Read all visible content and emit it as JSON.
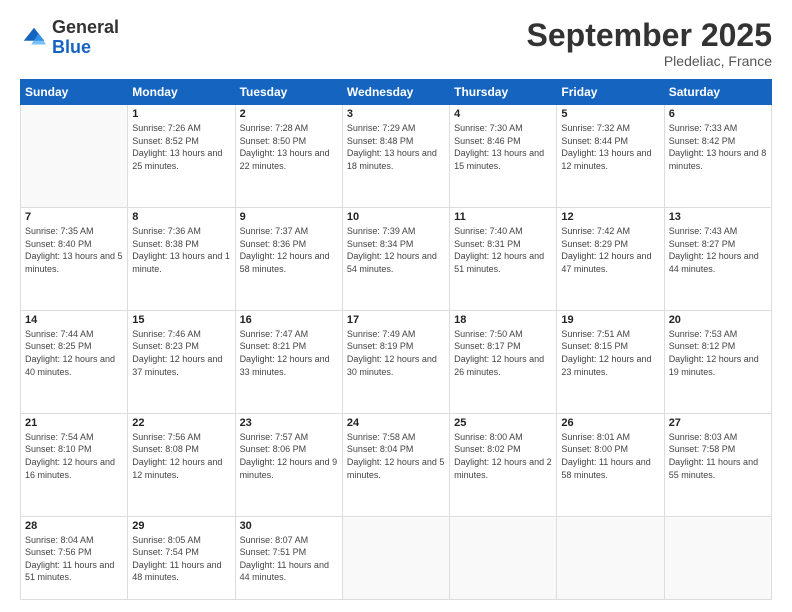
{
  "header": {
    "logo_general": "General",
    "logo_blue": "Blue",
    "month": "September 2025",
    "location": "Pledeliac, France"
  },
  "weekdays": [
    "Sunday",
    "Monday",
    "Tuesday",
    "Wednesday",
    "Thursday",
    "Friday",
    "Saturday"
  ],
  "weeks": [
    [
      {
        "day": "",
        "sunrise": "",
        "sunset": "",
        "daylight": ""
      },
      {
        "day": "1",
        "sunrise": "Sunrise: 7:26 AM",
        "sunset": "Sunset: 8:52 PM",
        "daylight": "Daylight: 13 hours and 25 minutes."
      },
      {
        "day": "2",
        "sunrise": "Sunrise: 7:28 AM",
        "sunset": "Sunset: 8:50 PM",
        "daylight": "Daylight: 13 hours and 22 minutes."
      },
      {
        "day": "3",
        "sunrise": "Sunrise: 7:29 AM",
        "sunset": "Sunset: 8:48 PM",
        "daylight": "Daylight: 13 hours and 18 minutes."
      },
      {
        "day": "4",
        "sunrise": "Sunrise: 7:30 AM",
        "sunset": "Sunset: 8:46 PM",
        "daylight": "Daylight: 13 hours and 15 minutes."
      },
      {
        "day": "5",
        "sunrise": "Sunrise: 7:32 AM",
        "sunset": "Sunset: 8:44 PM",
        "daylight": "Daylight: 13 hours and 12 minutes."
      },
      {
        "day": "6",
        "sunrise": "Sunrise: 7:33 AM",
        "sunset": "Sunset: 8:42 PM",
        "daylight": "Daylight: 13 hours and 8 minutes."
      }
    ],
    [
      {
        "day": "7",
        "sunrise": "Sunrise: 7:35 AM",
        "sunset": "Sunset: 8:40 PM",
        "daylight": "Daylight: 13 hours and 5 minutes."
      },
      {
        "day": "8",
        "sunrise": "Sunrise: 7:36 AM",
        "sunset": "Sunset: 8:38 PM",
        "daylight": "Daylight: 13 hours and 1 minute."
      },
      {
        "day": "9",
        "sunrise": "Sunrise: 7:37 AM",
        "sunset": "Sunset: 8:36 PM",
        "daylight": "Daylight: 12 hours and 58 minutes."
      },
      {
        "day": "10",
        "sunrise": "Sunrise: 7:39 AM",
        "sunset": "Sunset: 8:34 PM",
        "daylight": "Daylight: 12 hours and 54 minutes."
      },
      {
        "day": "11",
        "sunrise": "Sunrise: 7:40 AM",
        "sunset": "Sunset: 8:31 PM",
        "daylight": "Daylight: 12 hours and 51 minutes."
      },
      {
        "day": "12",
        "sunrise": "Sunrise: 7:42 AM",
        "sunset": "Sunset: 8:29 PM",
        "daylight": "Daylight: 12 hours and 47 minutes."
      },
      {
        "day": "13",
        "sunrise": "Sunrise: 7:43 AM",
        "sunset": "Sunset: 8:27 PM",
        "daylight": "Daylight: 12 hours and 44 minutes."
      }
    ],
    [
      {
        "day": "14",
        "sunrise": "Sunrise: 7:44 AM",
        "sunset": "Sunset: 8:25 PM",
        "daylight": "Daylight: 12 hours and 40 minutes."
      },
      {
        "day": "15",
        "sunrise": "Sunrise: 7:46 AM",
        "sunset": "Sunset: 8:23 PM",
        "daylight": "Daylight: 12 hours and 37 minutes."
      },
      {
        "day": "16",
        "sunrise": "Sunrise: 7:47 AM",
        "sunset": "Sunset: 8:21 PM",
        "daylight": "Daylight: 12 hours and 33 minutes."
      },
      {
        "day": "17",
        "sunrise": "Sunrise: 7:49 AM",
        "sunset": "Sunset: 8:19 PM",
        "daylight": "Daylight: 12 hours and 30 minutes."
      },
      {
        "day": "18",
        "sunrise": "Sunrise: 7:50 AM",
        "sunset": "Sunset: 8:17 PM",
        "daylight": "Daylight: 12 hours and 26 minutes."
      },
      {
        "day": "19",
        "sunrise": "Sunrise: 7:51 AM",
        "sunset": "Sunset: 8:15 PM",
        "daylight": "Daylight: 12 hours and 23 minutes."
      },
      {
        "day": "20",
        "sunrise": "Sunrise: 7:53 AM",
        "sunset": "Sunset: 8:12 PM",
        "daylight": "Daylight: 12 hours and 19 minutes."
      }
    ],
    [
      {
        "day": "21",
        "sunrise": "Sunrise: 7:54 AM",
        "sunset": "Sunset: 8:10 PM",
        "daylight": "Daylight: 12 hours and 16 minutes."
      },
      {
        "day": "22",
        "sunrise": "Sunrise: 7:56 AM",
        "sunset": "Sunset: 8:08 PM",
        "daylight": "Daylight: 12 hours and 12 minutes."
      },
      {
        "day": "23",
        "sunrise": "Sunrise: 7:57 AM",
        "sunset": "Sunset: 8:06 PM",
        "daylight": "Daylight: 12 hours and 9 minutes."
      },
      {
        "day": "24",
        "sunrise": "Sunrise: 7:58 AM",
        "sunset": "Sunset: 8:04 PM",
        "daylight": "Daylight: 12 hours and 5 minutes."
      },
      {
        "day": "25",
        "sunrise": "Sunrise: 8:00 AM",
        "sunset": "Sunset: 8:02 PM",
        "daylight": "Daylight: 12 hours and 2 minutes."
      },
      {
        "day": "26",
        "sunrise": "Sunrise: 8:01 AM",
        "sunset": "Sunset: 8:00 PM",
        "daylight": "Daylight: 11 hours and 58 minutes."
      },
      {
        "day": "27",
        "sunrise": "Sunrise: 8:03 AM",
        "sunset": "Sunset: 7:58 PM",
        "daylight": "Daylight: 11 hours and 55 minutes."
      }
    ],
    [
      {
        "day": "28",
        "sunrise": "Sunrise: 8:04 AM",
        "sunset": "Sunset: 7:56 PM",
        "daylight": "Daylight: 11 hours and 51 minutes."
      },
      {
        "day": "29",
        "sunrise": "Sunrise: 8:05 AM",
        "sunset": "Sunset: 7:54 PM",
        "daylight": "Daylight: 11 hours and 48 minutes."
      },
      {
        "day": "30",
        "sunrise": "Sunrise: 8:07 AM",
        "sunset": "Sunset: 7:51 PM",
        "daylight": "Daylight: 11 hours and 44 minutes."
      },
      {
        "day": "",
        "sunrise": "",
        "sunset": "",
        "daylight": ""
      },
      {
        "day": "",
        "sunrise": "",
        "sunset": "",
        "daylight": ""
      },
      {
        "day": "",
        "sunrise": "",
        "sunset": "",
        "daylight": ""
      },
      {
        "day": "",
        "sunrise": "",
        "sunset": "",
        "daylight": ""
      }
    ]
  ]
}
